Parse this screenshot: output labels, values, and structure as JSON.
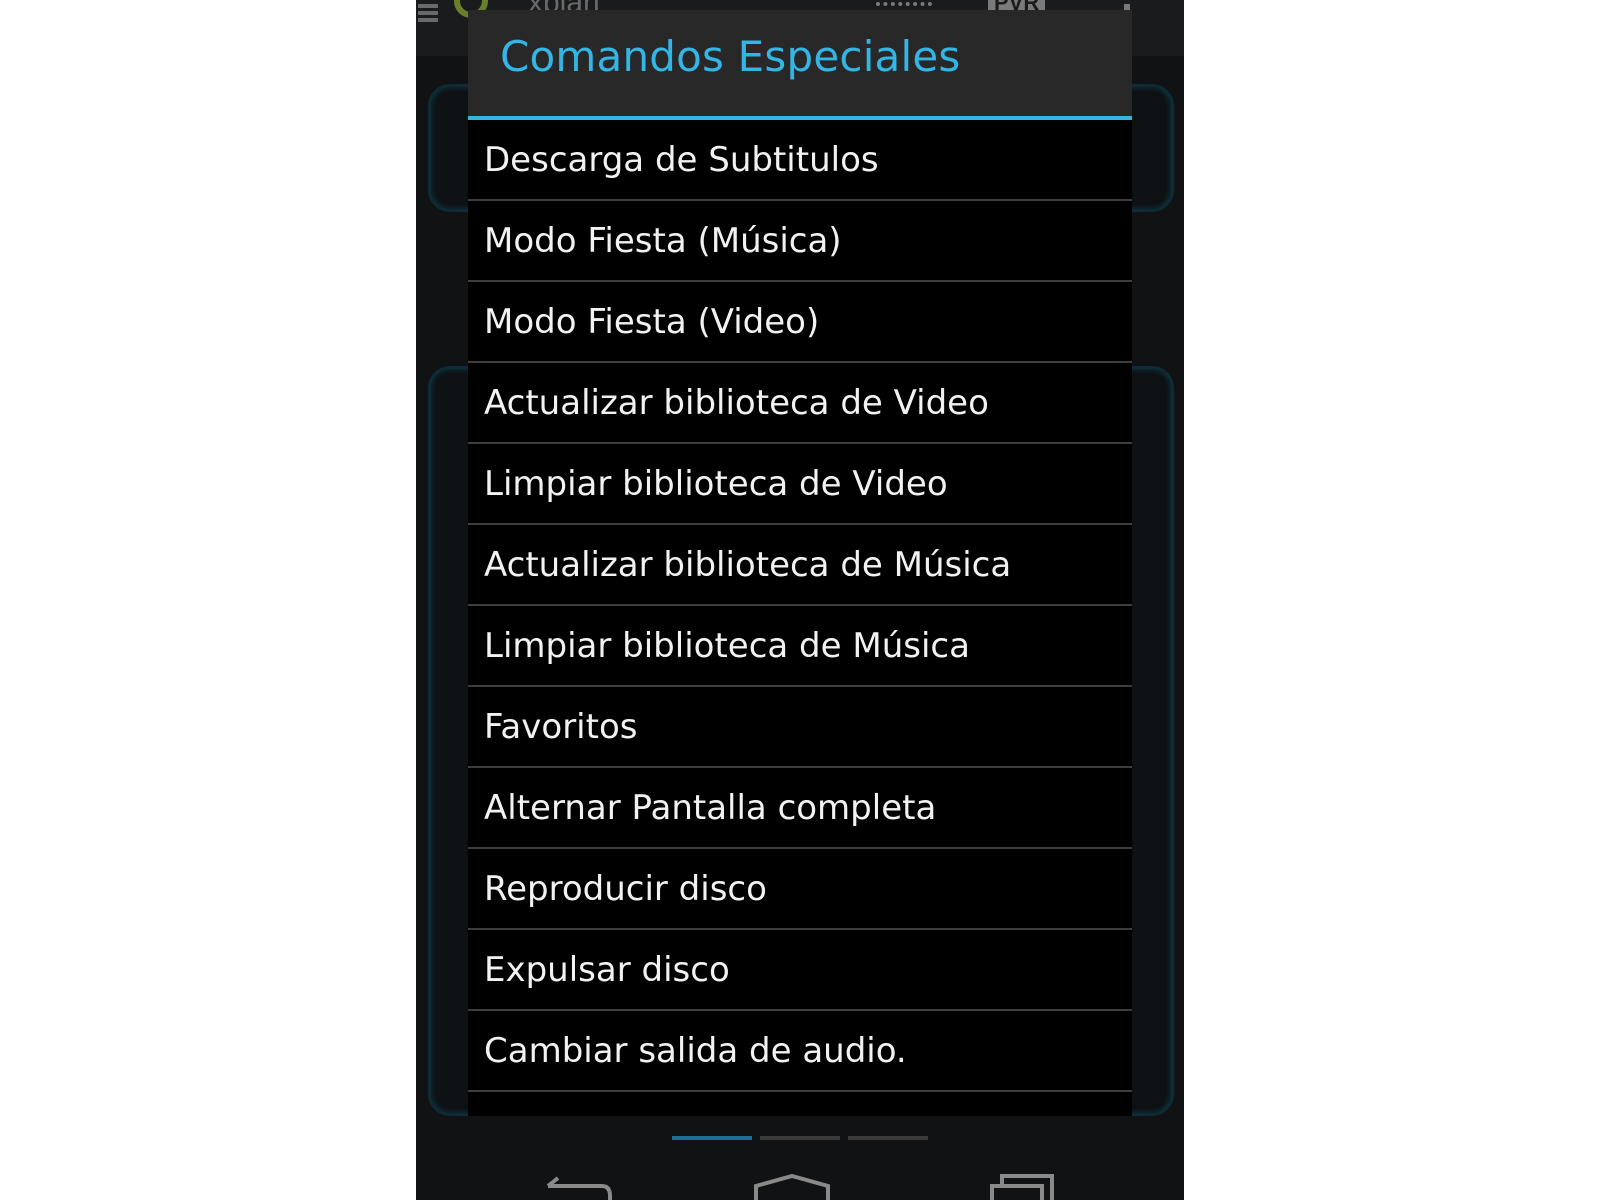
{
  "background_app": {
    "title": "xbian",
    "pvr_label": "PVR"
  },
  "dialog": {
    "title": "Comandos Especiales",
    "items": [
      {
        "label": "Descarga de Subtitulos"
      },
      {
        "label": "Modo Fiesta (Música)"
      },
      {
        "label": "Modo Fiesta (Video)"
      },
      {
        "label": "Actualizar biblioteca de Video"
      },
      {
        "label": "Limpiar biblioteca de Video"
      },
      {
        "label": "Actualizar biblioteca de Música"
      },
      {
        "label": "Limpiar biblioteca de Música"
      },
      {
        "label": "Favoritos"
      },
      {
        "label": "Alternar Pantalla completa"
      },
      {
        "label": "Reproducir disco"
      },
      {
        "label": "Expulsar disco"
      },
      {
        "label": "Cambiar salida de audio."
      }
    ]
  },
  "pager": {
    "pages": 3,
    "active_page": 1
  },
  "colors": {
    "accent": "#33b5e5",
    "dialog_header": "#282828",
    "dialog_body": "#000000"
  }
}
